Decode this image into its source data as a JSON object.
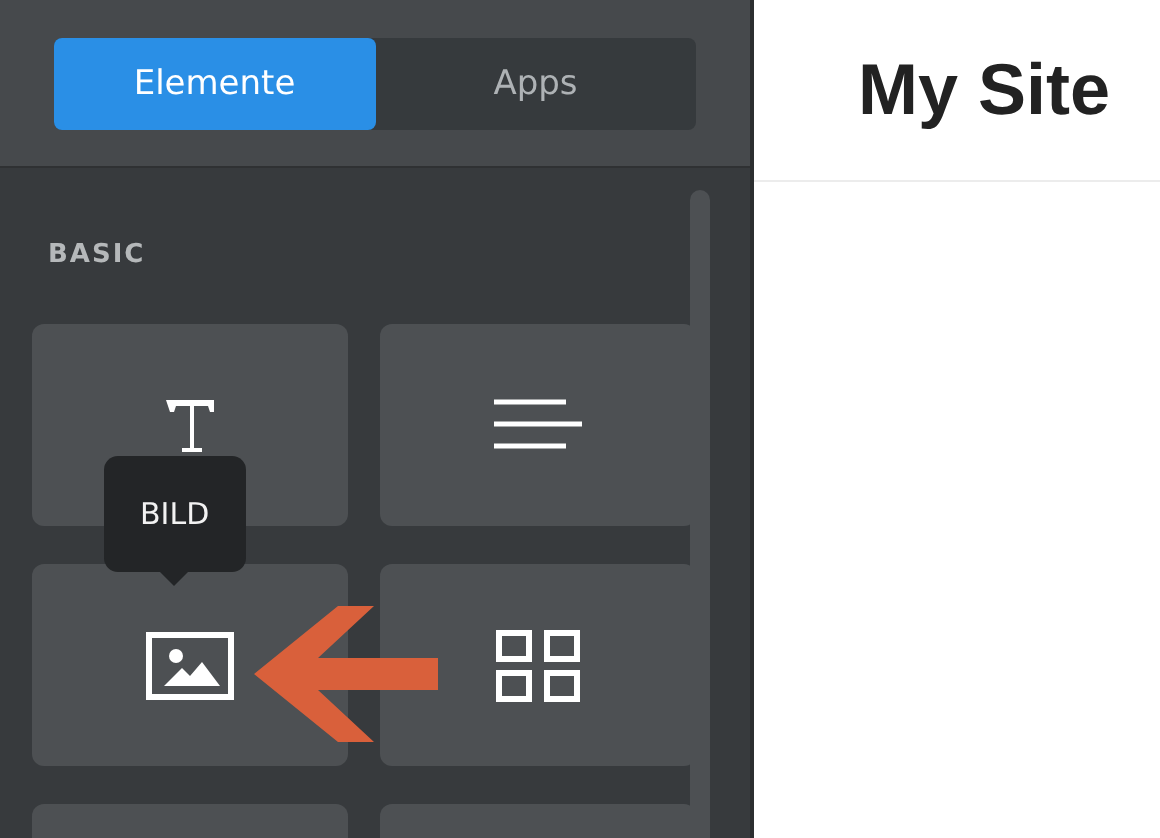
{
  "sidebar": {
    "tabs": [
      {
        "label": "Elemente",
        "selected": true
      },
      {
        "label": "Apps",
        "selected": false
      }
    ],
    "section_title": "BASIC",
    "tiles": [
      {
        "kind": "text"
      },
      {
        "kind": "paragraph"
      },
      {
        "kind": "image",
        "tooltip": "BILD"
      },
      {
        "kind": "gallery"
      },
      {
        "kind": "blank"
      },
      {
        "kind": "blank"
      }
    ]
  },
  "page": {
    "title": "My Site"
  }
}
